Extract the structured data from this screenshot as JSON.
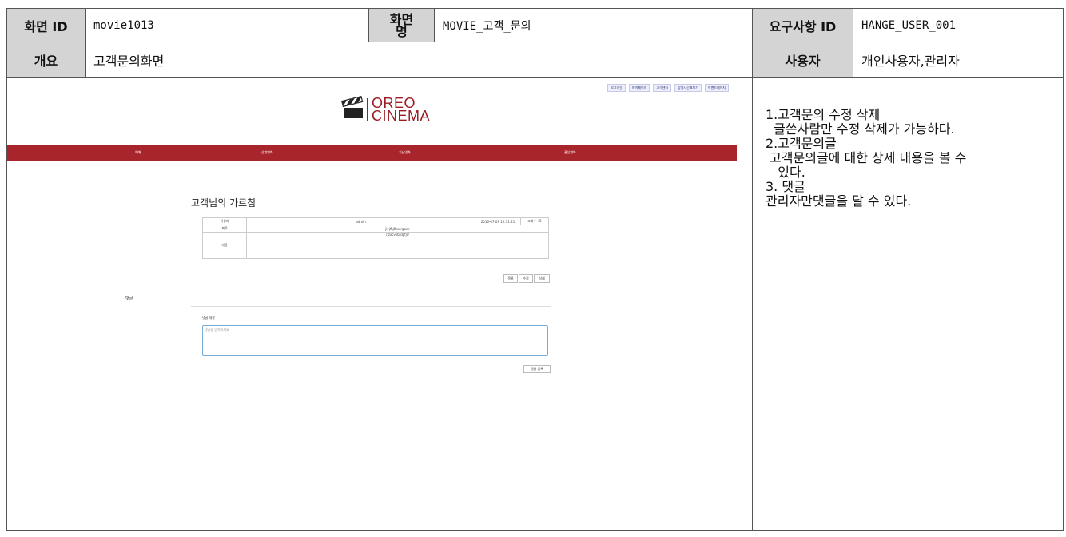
{
  "header": {
    "screen_id_label": "화면 ID",
    "screen_id_value": "movie1013",
    "screen_name_label": "화면명",
    "screen_name_value": "MOVIE_고객_문의",
    "req_id_label": "요구사항 ID",
    "req_id_value": "HANGE_USER_001",
    "overview_label": "개요",
    "overview_value": "고객문의화면",
    "user_label": "사용자",
    "user_value": "개인사용자,관리자"
  },
  "notes": "1.고객문의 수정 삭제\n  글쓴사람만 수정 삭제가 가능하다.\n2.고객문의글\n 고객문의글에 대한 상세 내용을 볼 수\n   있다.\n3. 댓글\n관리자만댓글을 달 수 있다.",
  "mockup": {
    "top_links": [
      "로그아웃",
      "마이페이지",
      "고객센터",
      "상영시간표보기",
      "이벤트페이지"
    ],
    "logo_line1": "OREO",
    "logo_line2": "CINEMA",
    "nav": [
      "예매",
      "상영영화",
      "지난영화",
      "관심영화"
    ],
    "page_title": "고객님의 가르침",
    "detail": {
      "writer_label": "작성자",
      "writer_value": "admin",
      "date_value": "2016-07-09 12:11:21",
      "views_value": "조회수 : 5",
      "subject_label": "제목",
      "subject_value": "jiyjfhjfhsergawr",
      "content_label": "내용",
      "content_value": "rjzxcvvbfdgfjrf"
    },
    "buttons": [
      "목록",
      "수정",
      "삭제"
    ],
    "reply_label": "댓글",
    "reply_sub": "댓글 내용",
    "reply_placeholder": "댓글을 입력하세요",
    "reply_button": "댓글 등록"
  }
}
